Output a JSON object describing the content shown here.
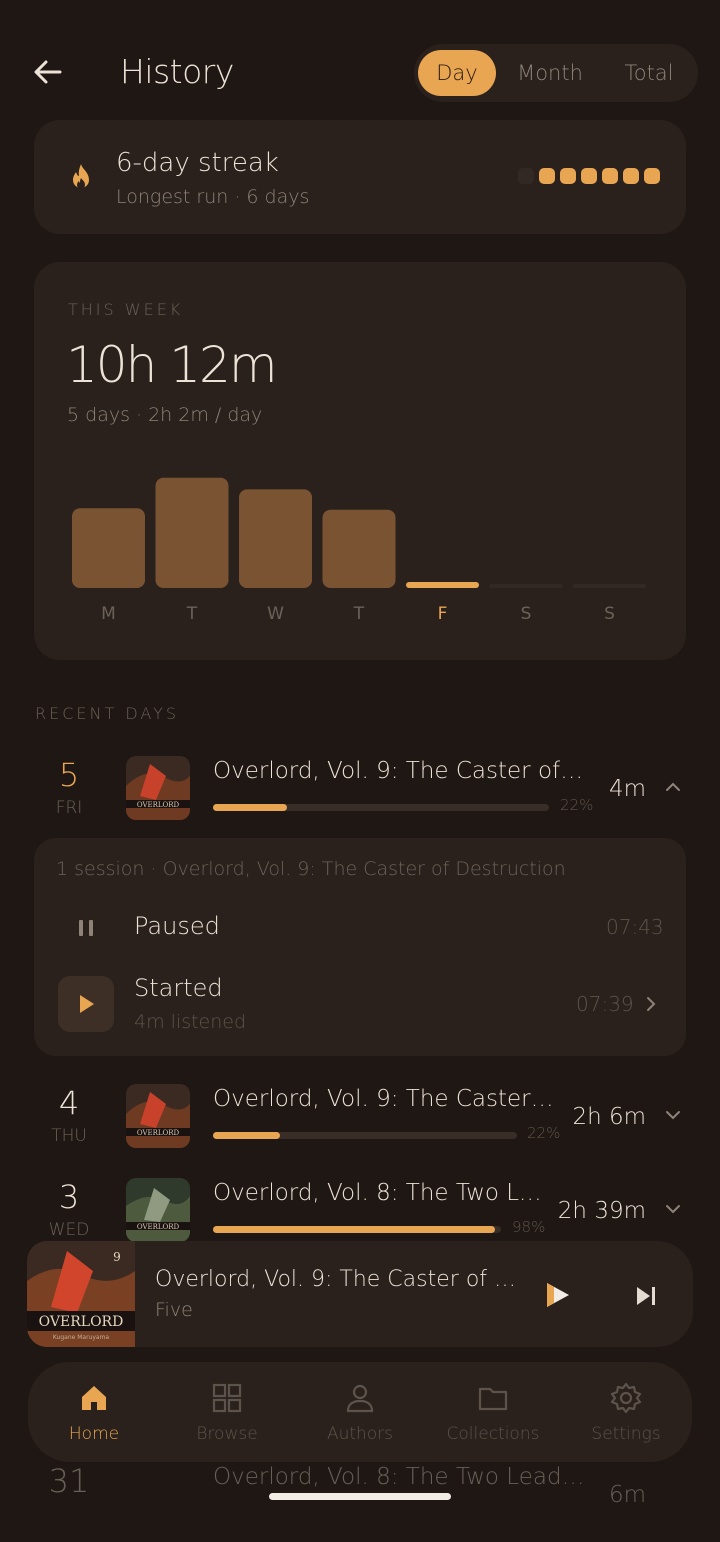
{
  "header": {
    "title": "History",
    "segments": [
      "Day",
      "Month",
      "Total"
    ],
    "active_segment": "Day"
  },
  "streak": {
    "title": "6-day streak",
    "subtitle": "Longest run · 6 days",
    "active_days": 6,
    "total_days": 7
  },
  "week": {
    "label": "THIS WEEK",
    "total": "10h 12m",
    "summary": "5 days · 2h 2m / day"
  },
  "chart_data": {
    "type": "bar",
    "categories": [
      "M",
      "T",
      "W",
      "T",
      "F",
      "S",
      "S"
    ],
    "values": [
      2.75,
      3.8,
      3.4,
      2.7,
      0.07,
      0,
      0
    ],
    "highlight": "F",
    "ylim": [
      0,
      4
    ]
  },
  "recent": {
    "label": "RECENT DAYS",
    "rows": [
      {
        "day": "5",
        "weekday": "FRI",
        "title": "Overlord, Vol. 9: The Caster of De...",
        "progress_label": "22%",
        "progress": 0.22,
        "duration": "4m",
        "expanded": true
      },
      {
        "day": "4",
        "weekday": "THU",
        "title": "Overlord, Vol. 9: The Caster of ...",
        "progress_label": "22%",
        "progress": 0.22,
        "duration": "2h 6m",
        "expanded": false
      },
      {
        "day": "3",
        "weekday": "WED",
        "title": "Overlord, Vol. 8: The Two Lead...",
        "progress_label": "98%",
        "progress": 0.98,
        "duration": "2h 39m",
        "expanded": false
      },
      {
        "day": "31",
        "weekday": "",
        "title": "Overlord, Vol. 8: The Two Leaders",
        "duration": "6m"
      }
    ]
  },
  "session": {
    "header": "1 session · Overlord, Vol. 9: The Caster of Destruction",
    "events": [
      {
        "label": "Paused",
        "time": "07:43"
      },
      {
        "label": "Started",
        "sub": "4m listened",
        "time": "07:39"
      }
    ]
  },
  "player": {
    "title": "Overlord, Vol. 9: The Caster of Des...",
    "subtitle": "Five"
  },
  "cover": {
    "series": "OVERLORD",
    "author_line": "Kugane Maruyama",
    "volume": "9"
  },
  "nav": {
    "items": [
      "Home",
      "Browse",
      "Authors",
      "Collections",
      "Settings"
    ],
    "active": "Home"
  },
  "colors": {
    "background": "#1f1714",
    "card": "#2a211d",
    "accent": "#e8a552",
    "bar": "#7a5432"
  }
}
